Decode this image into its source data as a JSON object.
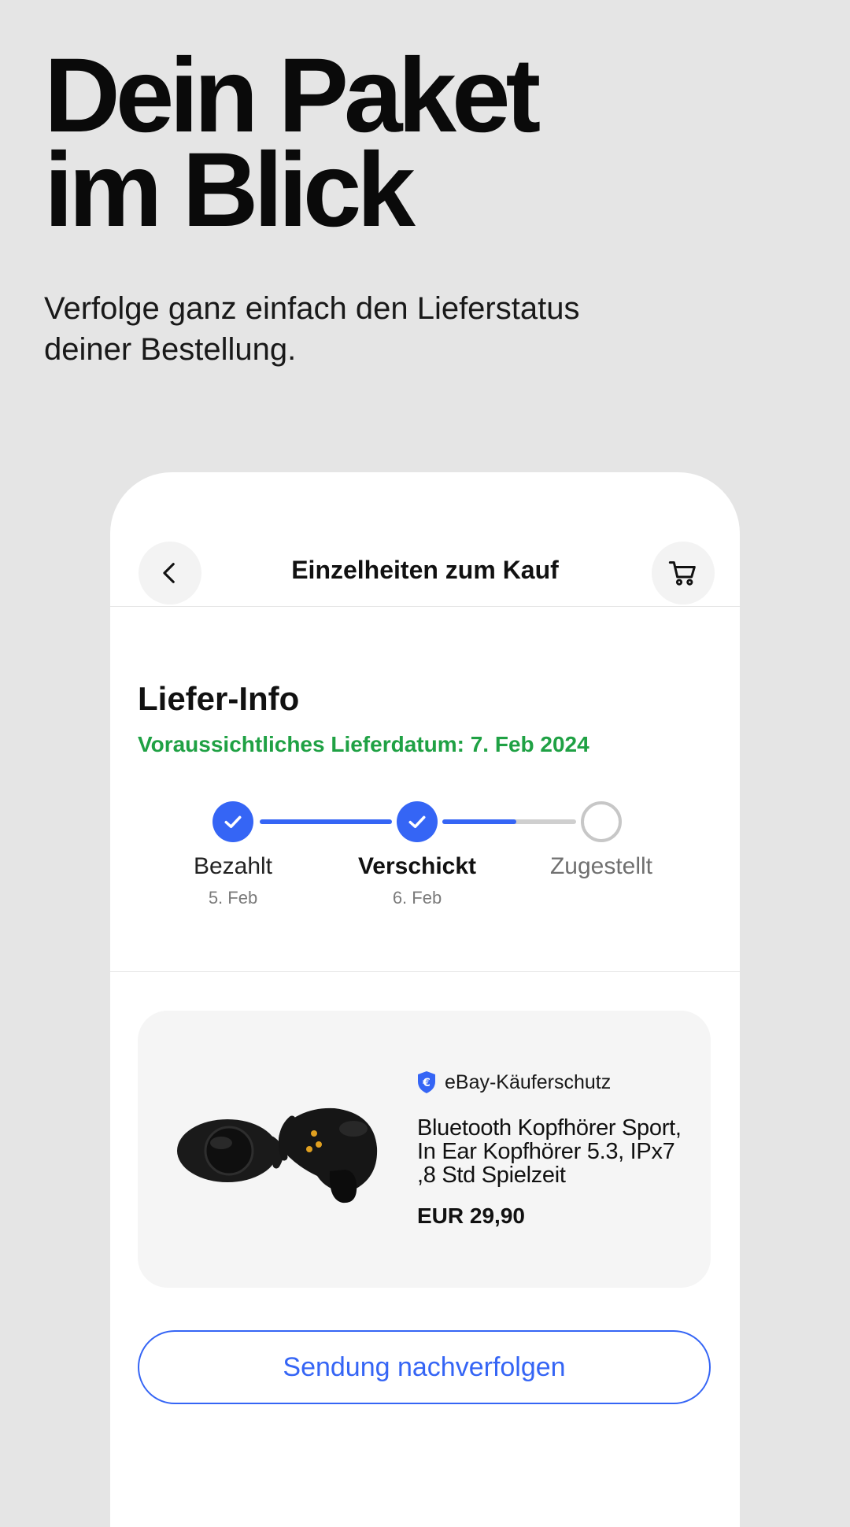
{
  "promo": {
    "headline": "Dein Paket\nim Blick",
    "subline": "Verfolge ganz einfach den Lieferstatus\ndeiner Bestellung."
  },
  "header": {
    "title": "Einzelheiten zum Kauf",
    "back_icon": "chevron-left-icon",
    "cart_icon": "cart-icon"
  },
  "delivery": {
    "section_title": "Liefer-Info",
    "estimated_date": "Voraussichtliches Lieferdatum: 7. Feb 2024",
    "steps": [
      {
        "label": "Bezahlt",
        "date": "5. Feb",
        "state": "done"
      },
      {
        "label": "Verschickt",
        "date": "6. Feb",
        "state": "done"
      },
      {
        "label": "Zugestellt",
        "date": "",
        "state": "pending"
      }
    ],
    "progress_second_segment": 0.55
  },
  "item": {
    "protection_label": "eBay-Käuferschutz",
    "protection_icon": "shield-euro-icon",
    "title": "Bluetooth Kopfhörer Sport, In Ear Kopfhörer 5.3, IPx7 ,8 Std Spielzeit",
    "price": "EUR 29,90"
  },
  "actions": {
    "track_label": "Sendung nachverfolgen"
  },
  "colors": {
    "accent": "#3565f5",
    "success": "#1fa144",
    "background": "#e5e5e5"
  }
}
